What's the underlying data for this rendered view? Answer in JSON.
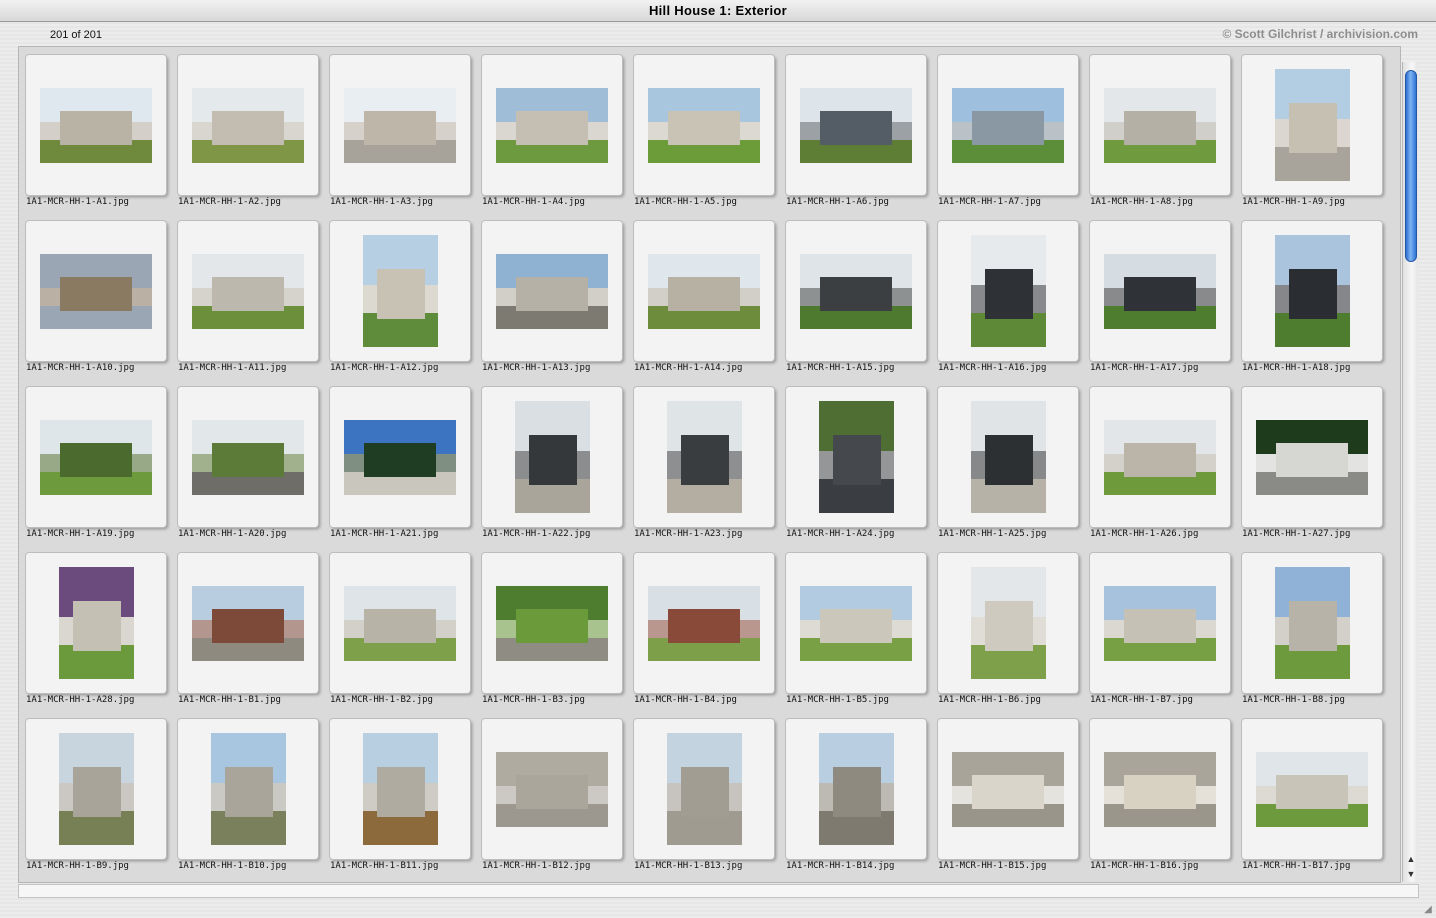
{
  "window": {
    "title": "Hill House 1: Exterior",
    "count_label": "201 of 201",
    "credit": "© Scott Gilchrist / archivision.com"
  },
  "icons": {
    "scroll_up": "scroll-up-arrow-icon",
    "scroll_down": "scroll-down-arrow-icon",
    "resize": "resize-grip-icon"
  },
  "thumbnails": [
    {
      "file": "1A1-MCR-HH-1-A1.jpg",
      "orient": "landscape",
      "sky": "#dfe8ee",
      "ground": "#6f8a3c",
      "bldg": "#b9b3a6"
    },
    {
      "file": "1A1-MCR-HH-1-A2.jpg",
      "orient": "landscape",
      "sky": "#e4e9ec",
      "ground": "#7e9646",
      "bldg": "#c3bdb1"
    },
    {
      "file": "1A1-MCR-HH-1-A3.jpg",
      "orient": "landscape",
      "sky": "#e9eef2",
      "ground": "#a7a39a",
      "bldg": "#bdb6a9"
    },
    {
      "file": "1A1-MCR-HH-1-A4.jpg",
      "orient": "landscape",
      "sky": "#9fbdd6",
      "ground": "#6d9a3e",
      "bldg": "#c4bfb2"
    },
    {
      "file": "1A1-MCR-HH-1-A5.jpg",
      "orient": "landscape",
      "sky": "#a9c6df",
      "ground": "#6c9b3a",
      "bldg": "#c9c3b6"
    },
    {
      "file": "1A1-MCR-HH-1-A6.jpg",
      "orient": "landscape",
      "sky": "#dde4ea",
      "ground": "#5e7d35",
      "bldg": "#545d66"
    },
    {
      "file": "1A1-MCR-HH-1-A7.jpg",
      "orient": "landscape",
      "sky": "#9ec0de",
      "ground": "#5c8e3a",
      "bldg": "#8a98a3"
    },
    {
      "file": "1A1-MCR-HH-1-A8.jpg",
      "orient": "landscape",
      "sky": "#e3e7ea",
      "ground": "#6f9a3e",
      "bldg": "#b4b0a6"
    },
    {
      "file": "1A1-MCR-HH-1-A9.jpg",
      "orient": "portrait",
      "sky": "#b3cde2",
      "ground": "#a8a49b",
      "bldg": "#c6c0b3"
    },
    {
      "file": "1A1-MCR-HH-1-A10.jpg",
      "orient": "landscape",
      "sky": "#9aa6b3",
      "ground": "#9aa6b3",
      "bldg": "#8a7a62"
    },
    {
      "file": "1A1-MCR-HH-1-A11.jpg",
      "orient": "landscape",
      "sky": "#e3e7ea",
      "ground": "#6b8f3b",
      "bldg": "#bdb8ad"
    },
    {
      "file": "1A1-MCR-HH-1-A12.jpg",
      "orient": "portrait",
      "sky": "#b7cfe2",
      "ground": "#5f8c3a",
      "bldg": "#c8c2b5"
    },
    {
      "file": "1A1-MCR-HH-1-A13.jpg",
      "orient": "landscape",
      "sky": "#8fb2d3",
      "ground": "#7d7a72",
      "bldg": "#b6b1a6"
    },
    {
      "file": "1A1-MCR-HH-1-A14.jpg",
      "orient": "landscape",
      "sky": "#dfe6ec",
      "ground": "#6d8c3c",
      "bldg": "#b7b1a4"
    },
    {
      "file": "1A1-MCR-HH-1-A15.jpg",
      "orient": "landscape",
      "sky": "#dfe4e8",
      "ground": "#4e7a2f",
      "bldg": "#3b3f42"
    },
    {
      "file": "1A1-MCR-HH-1-A16.jpg",
      "orient": "portrait",
      "sky": "#e6eaed",
      "ground": "#5e8a38",
      "bldg": "#2e3236"
    },
    {
      "file": "1A1-MCR-HH-1-A17.jpg",
      "orient": "landscape",
      "sky": "#d6dde2",
      "ground": "#4f7d30",
      "bldg": "#2f3337"
    },
    {
      "file": "1A1-MCR-HH-1-A18.jpg",
      "orient": "portrait",
      "sky": "#a9c4dc",
      "ground": "#4f7d30",
      "bldg": "#2a2e33"
    },
    {
      "file": "1A1-MCR-HH-1-A19.jpg",
      "orient": "landscape",
      "sky": "#dfe6ea",
      "ground": "#6c9a3c",
      "bldg": "#4b6b2e"
    },
    {
      "file": "1A1-MCR-HH-1-A20.jpg",
      "orient": "landscape",
      "sky": "#e2e7ea",
      "ground": "#6f6d68",
      "bldg": "#5c7a38"
    },
    {
      "file": "1A1-MCR-HH-1-A21.jpg",
      "orient": "landscape",
      "sky": "#3d74c2",
      "ground": "#c8c6bd",
      "bldg": "#1f3d22"
    },
    {
      "file": "1A1-MCR-HH-1-A22.jpg",
      "orient": "portrait",
      "sky": "#d9dfe3",
      "ground": "#aaa59a",
      "bldg": "#35383b"
    },
    {
      "file": "1A1-MCR-HH-1-A23.jpg",
      "orient": "portrait",
      "sky": "#dfe4e6",
      "ground": "#b4aea2",
      "bldg": "#3a3d40"
    },
    {
      "file": "1A1-MCR-HH-1-A24.jpg",
      "orient": "portrait",
      "sky": "#4f6e34",
      "ground": "#3a3e42",
      "bldg": "#45494d"
    },
    {
      "file": "1A1-MCR-HH-1-A25.jpg",
      "orient": "portrait",
      "sky": "#e1e4e6",
      "ground": "#b6b2a7",
      "bldg": "#2c3033"
    },
    {
      "file": "1A1-MCR-HH-1-A26.jpg",
      "orient": "landscape",
      "sky": "#e2e6e9",
      "ground": "#6e9a3c",
      "bldg": "#bab5a8"
    },
    {
      "file": "1A1-MCR-HH-1-A27.jpg",
      "orient": "landscape",
      "sky": "#1e3b1c",
      "ground": "#8a8a86",
      "bldg": "#d6d6d3"
    },
    {
      "file": "1A1-MCR-HH-1-A28.jpg",
      "orient": "portrait",
      "sky": "#6b4a7d",
      "ground": "#6a9a3c",
      "bldg": "#c5c0b4"
    },
    {
      "file": "1A1-MCR-HH-1-B1.jpg",
      "orient": "landscape",
      "sky": "#b8cde0",
      "ground": "#8f8a80",
      "bldg": "#7d4a3a"
    },
    {
      "file": "1A1-MCR-HH-1-B2.jpg",
      "orient": "landscape",
      "sky": "#dfe4e8",
      "ground": "#7fa04a",
      "bldg": "#b8b3a7"
    },
    {
      "file": "1A1-MCR-HH-1-B3.jpg",
      "orient": "landscape",
      "sky": "#4f7d30",
      "ground": "#8f8c84",
      "bldg": "#6a9a3a"
    },
    {
      "file": "1A1-MCR-HH-1-B4.jpg",
      "orient": "landscape",
      "sky": "#d8e0e6",
      "ground": "#7e9f4a",
      "bldg": "#8a4a3a"
    },
    {
      "file": "1A1-MCR-HH-1-B5.jpg",
      "orient": "landscape",
      "sky": "#b2cbe0",
      "ground": "#7aa046",
      "bldg": "#ccc7bb"
    },
    {
      "file": "1A1-MCR-HH-1-B6.jpg",
      "orient": "portrait",
      "sky": "#e3e7ea",
      "ground": "#7fa04a",
      "bldg": "#cfcac0"
    },
    {
      "file": "1A1-MCR-HH-1-B7.jpg",
      "orient": "landscape",
      "sky": "#a6c2dc",
      "ground": "#76a043",
      "bldg": "#c6c1b5"
    },
    {
      "file": "1A1-MCR-HH-1-B8.jpg",
      "orient": "portrait",
      "sky": "#8fb2d6",
      "ground": "#6d9a3c",
      "bldg": "#b8b3a8"
    },
    {
      "file": "1A1-MCR-HH-1-B9.jpg",
      "orient": "portrait",
      "sky": "#c9d5de",
      "ground": "#777f55",
      "bldg": "#a9a49a"
    },
    {
      "file": "1A1-MCR-HH-1-B10.jpg",
      "orient": "portrait",
      "sky": "#a9c6e0",
      "ground": "#7a7f5c",
      "bldg": "#aaa59b"
    },
    {
      "file": "1A1-MCR-HH-1-B11.jpg",
      "orient": "portrait",
      "sky": "#b8cfe2",
      "ground": "#8c6a3c",
      "bldg": "#b0aba0"
    },
    {
      "file": "1A1-MCR-HH-1-B12.jpg",
      "orient": "landscape",
      "sky": "#b0aba1",
      "ground": "#9d988f",
      "bldg": "#aba69c"
    },
    {
      "file": "1A1-MCR-HH-1-B13.jpg",
      "orient": "portrait",
      "sky": "#c3d3e0",
      "ground": "#a09b91",
      "bldg": "#a29d93"
    },
    {
      "file": "1A1-MCR-HH-1-B14.jpg",
      "orient": "portrait",
      "sky": "#b9cfe1",
      "ground": "#7f7a70",
      "bldg": "#8f8a80"
    },
    {
      "file": "1A1-MCR-HH-1-B15.jpg",
      "orient": "landscape",
      "sky": "#a9a49a",
      "ground": "#9a958b",
      "bldg": "#d9d5cb"
    },
    {
      "file": "1A1-MCR-HH-1-B16.jpg",
      "orient": "landscape",
      "sky": "#aaa59b",
      "ground": "#9b968c",
      "bldg": "#d8d2c2"
    },
    {
      "file": "1A1-MCR-HH-1-B17.jpg",
      "orient": "landscape",
      "sky": "#dfe5e8",
      "ground": "#6c9a3c",
      "bldg": "#c9c4b8"
    }
  ]
}
